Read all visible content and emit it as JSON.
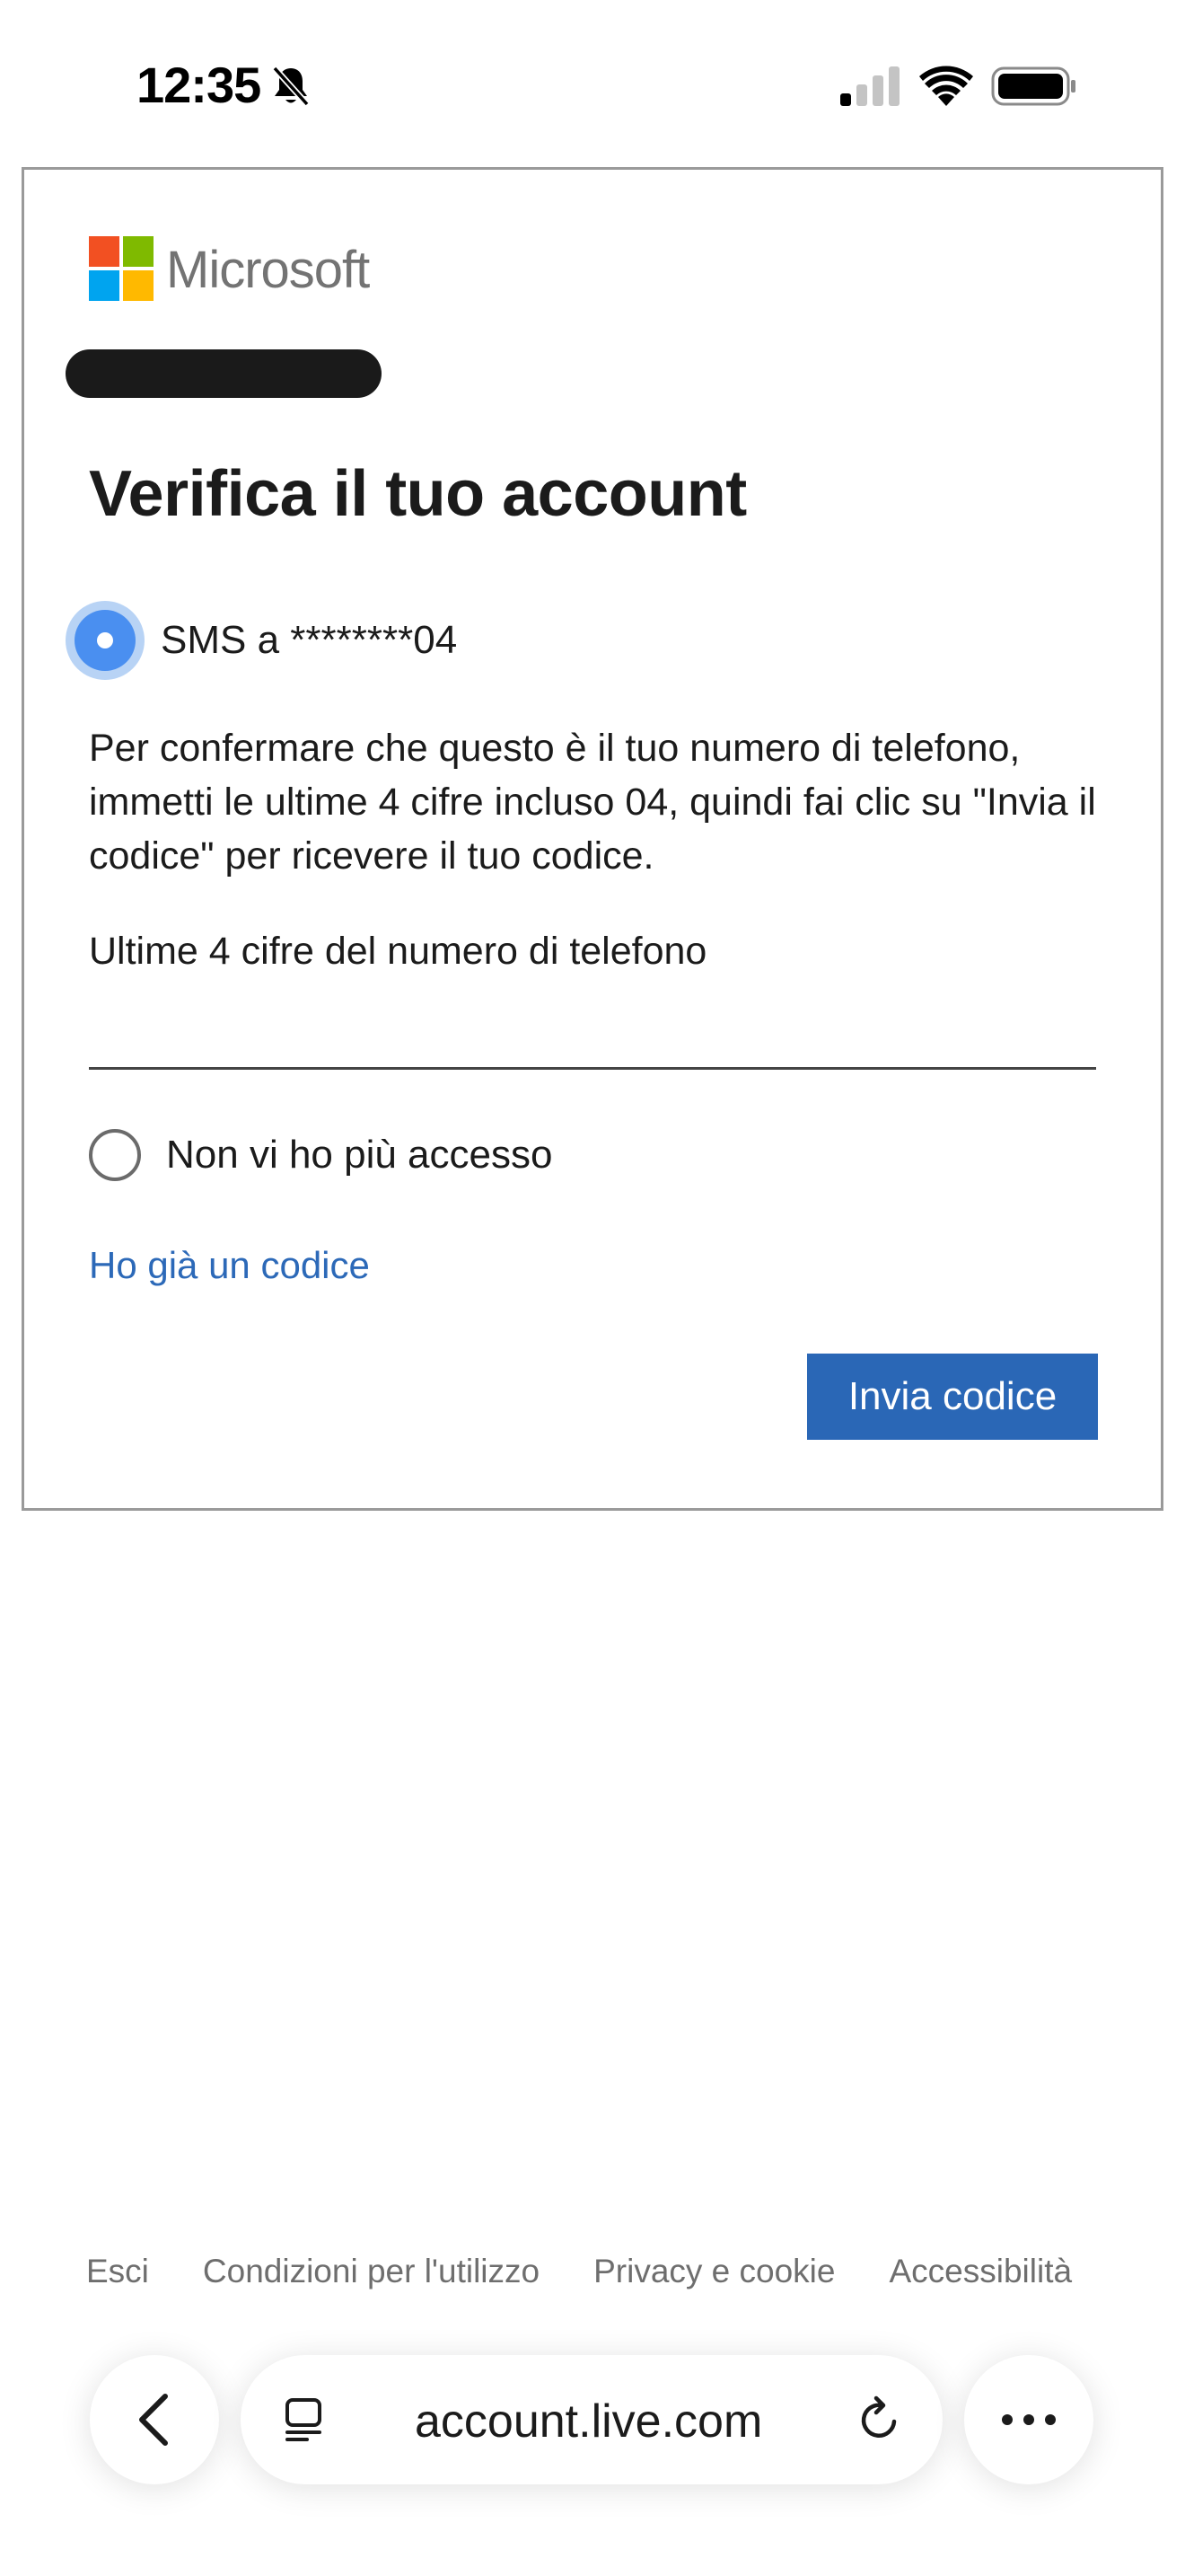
{
  "status_bar": {
    "time": "12:35"
  },
  "card": {
    "brand": "Microsoft",
    "title": "Verifica il tuo account",
    "sms_option_label": "SMS a ********04",
    "description": "Per confermare che questo è il tuo numero di telefono, immetti le ultime 4 cifre incluso 04, quindi fai clic su \"Invia il codice\" per ricevere il tuo codice.",
    "field_label": "Ultime 4 cifre del numero di telefono",
    "field_value": "",
    "no_access_label": "Non vi ho più accesso",
    "have_code_link": "Ho già un codice",
    "send_button": "Invia codice"
  },
  "footer": {
    "links": [
      "Esci",
      "Condizioni per l'utilizzo",
      "Privacy e cookie",
      "Accessibilità"
    ]
  },
  "browser": {
    "url": "account.live.com"
  },
  "colors": {
    "accent": "#2a67b6",
    "link": "#2c69b8",
    "radio_selected": "#4a8ff0",
    "ms_red": "#f25022",
    "ms_green": "#7fba00",
    "ms_blue": "#00a4ef",
    "ms_yellow": "#ffb900"
  },
  "icons": [
    "bell-off-icon",
    "signal-icon",
    "wifi-icon",
    "battery-icon",
    "back-icon",
    "tabs-icon",
    "reload-icon",
    "more-icon"
  ]
}
